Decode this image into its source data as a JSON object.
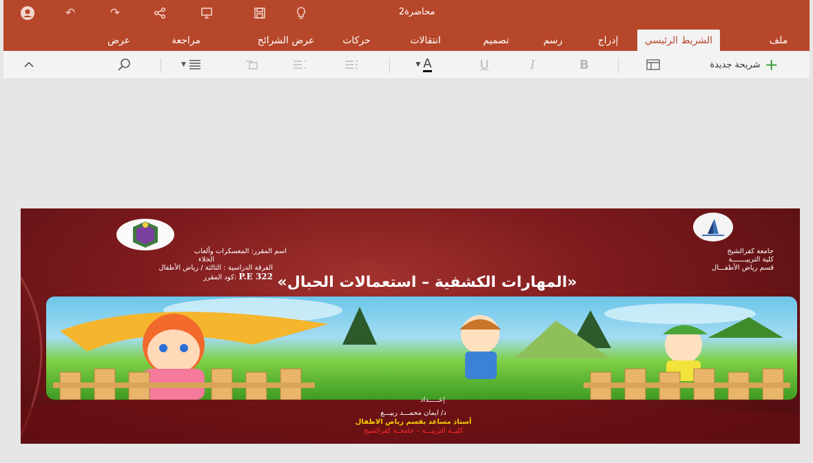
{
  "window": {
    "doc_title": "محاضرة2",
    "quick_access": [
      "account-icon",
      "undo-icon",
      "redo-icon",
      "share-icon",
      "present-icon",
      "save-icon",
      "lightbulb-icon"
    ]
  },
  "tabs": [
    {
      "label": "ملف",
      "active": false
    },
    {
      "label": "الشريط الرئيسي",
      "active": true
    },
    {
      "label": "إدراج",
      "active": false
    },
    {
      "label": "رسم",
      "active": false
    },
    {
      "label": "تصميم",
      "active": false
    },
    {
      "label": "انتقالات",
      "active": false
    },
    {
      "label": "حركات",
      "active": false
    },
    {
      "label": "عرض الشرائح",
      "active": false
    },
    {
      "label": "مراجعة",
      "active": false
    },
    {
      "label": "عرض",
      "active": false
    }
  ],
  "ribbon": {
    "new_slide_label": "شريحة جديدة",
    "bold_label": "B",
    "italic_label": "I",
    "underline_label": "U",
    "font_color_label": "A",
    "font_color": "#000000"
  },
  "colors": {
    "accent": "#b7472a",
    "canvas": "#e6e6e6"
  },
  "slide": {
    "right_block": [
      "جامعة كفرالشيخ",
      "كلية التربيـــــــة",
      "قسم رياض الأطفـــال"
    ],
    "left_block": {
      "course_name": "اسم المقرر: المعسكرات وألعاب",
      "line2": "الخلاء",
      "line3": "الفرقة الدراسية : الثالثة / رياض الأطفال",
      "code_label": "كود المقرر:",
      "code_value": "P.E 322"
    },
    "title": "«المهارات الكشفية – استعمالات الحبال»",
    "prepared_by": "إعـــــداد",
    "author": "د/ ايمان محمـــد ربيـــع",
    "author_title": "أستاذ مساعد بقسم رياض الاطفال",
    "author_affiliation": "كليــة التربيـــة – جامعــة كفرالشيخ"
  }
}
